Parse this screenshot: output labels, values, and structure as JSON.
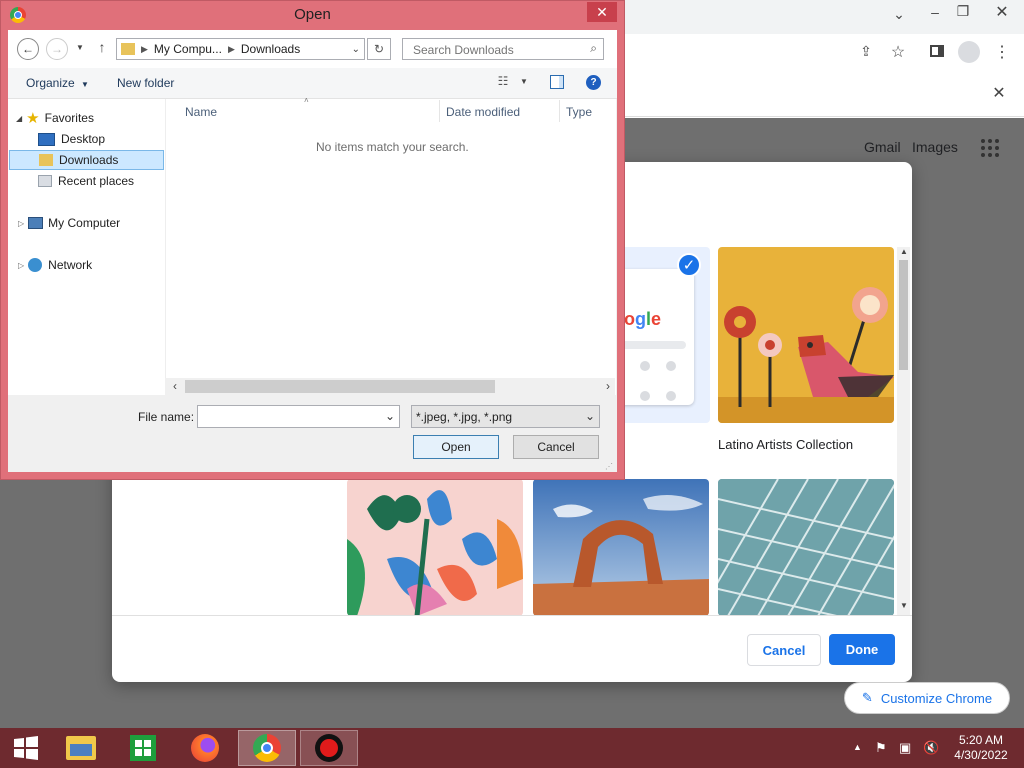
{
  "chrome": {
    "gmail_label": "Gmail",
    "images_label": "Images",
    "customize_label": "Customize Chrome"
  },
  "modal": {
    "tile_caption": "Latino Artists Collection",
    "cancel_label": "Cancel",
    "done_label": "Done"
  },
  "dialog": {
    "title": "Open",
    "breadcrumb": [
      "My Compu...",
      "Downloads"
    ],
    "search_placeholder": "Search Downloads",
    "organize_label": "Organize",
    "new_folder_label": "New folder",
    "tree": {
      "favorites": "Favorites",
      "desktop": "Desktop",
      "downloads": "Downloads",
      "recent": "Recent places",
      "computer": "My Computer",
      "network": "Network"
    },
    "columns": {
      "name": "Name",
      "date": "Date modified",
      "type": "Type"
    },
    "empty_message": "No items match your search.",
    "file_name_label": "File name:",
    "file_name_value": "",
    "filter_value": "*.jpeg, *.jpg, *.png",
    "open_label": "Open",
    "cancel_label": "Cancel"
  },
  "taskbar": {
    "time": "5:20 AM",
    "date": "4/30/2022"
  },
  "colors": {
    "dialog_frame": "#e0707a",
    "taskbar": "#6e2a2f",
    "accent": "#1a73e8"
  }
}
